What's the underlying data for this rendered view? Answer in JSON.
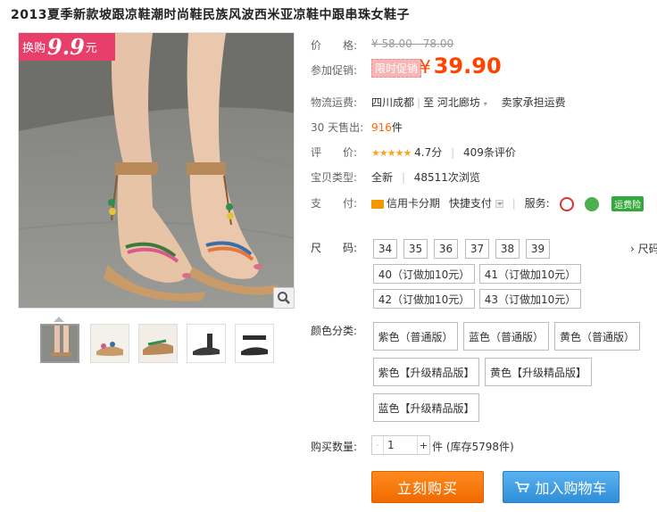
{
  "title": "2013夏季新款坡跟凉鞋潮时尚鞋民族风波西米亚凉鞋中跟串珠女鞋子",
  "promo_badge": {
    "prefix": "换购",
    "price": "9.9",
    "suffix": "元"
  },
  "price": {
    "label": "价　　格:",
    "original": "¥ 58.00 - 78.00"
  },
  "promotion": {
    "label": "参加促销:",
    "tag": "限时促销",
    "currency": "¥",
    "price": "39.90"
  },
  "shipping": {
    "label": "物流运费:",
    "from": "四川成都",
    "sep": "|",
    "to_prefix": "至",
    "to": "河北廊坊",
    "fee": "卖家承担运费"
  },
  "sold": {
    "label": "30 天售出:",
    "count": "916",
    "unit": "件"
  },
  "rating": {
    "label": "评　　价:",
    "stars": "★★★★★",
    "score": "4.7分",
    "reviews": "409条评价"
  },
  "item_type": {
    "label": "宝贝类型:",
    "type": "全新",
    "views": "48511次浏览"
  },
  "payment": {
    "label": "支　　付:",
    "credit": "信用卡分期",
    "quick": "快捷支付",
    "service_label": "服务:",
    "insurance": "运费险"
  },
  "size": {
    "label": "尺　　码:",
    "more": "› 尺码",
    "options": [
      "34",
      "35",
      "36",
      "37",
      "38",
      "39",
      "40（订做加10元）",
      "41（订做加10元）",
      "42（订做加10元）",
      "43（订做加10元）"
    ]
  },
  "color": {
    "label": "颜色分类:",
    "options": [
      "紫色（普通版）",
      "蓝色（普通版）",
      "黄色（普通版）",
      "紫色【升级精品版】",
      "黄色【升级精品版】",
      "蓝色【升级精品版】"
    ]
  },
  "quantity": {
    "label": "购买数量:",
    "minus": "-",
    "value": "1",
    "plus": "+",
    "stock": "件 (库存5798件)"
  },
  "buttons": {
    "buy": "立刻购买",
    "cart": "加入购物车"
  },
  "icons": {
    "zoom": "magnifier-icon",
    "credit": "credit-card-icon",
    "cart": "cart-icon"
  },
  "colors": {
    "accent": "#ff4400",
    "promo_pink": "#e73f6a",
    "buy_orange": "#f67a0c",
    "cart_blue": "#3f9be0"
  }
}
